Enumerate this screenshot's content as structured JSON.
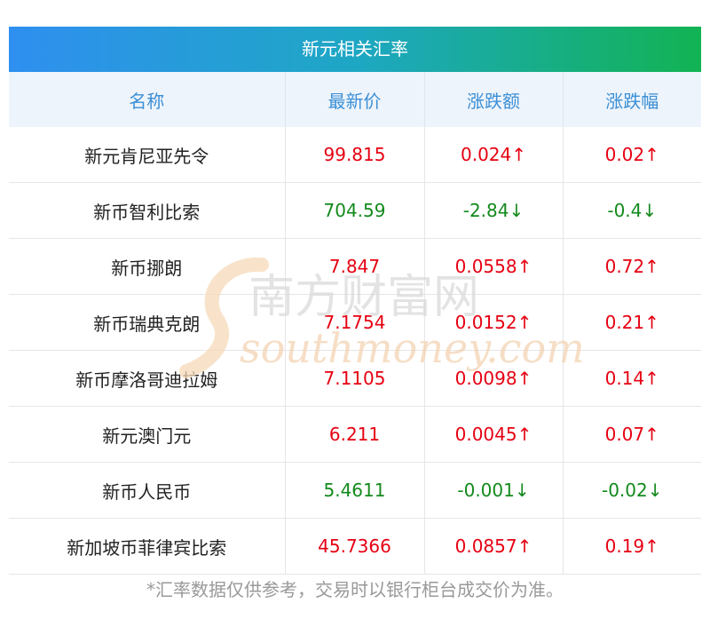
{
  "title": "新元相关汇率",
  "headers": [
    "名称",
    "最新价",
    "涨跌额",
    "涨跌幅"
  ],
  "rows": [
    {
      "name": "新元肯尼亚先令",
      "price": "99.815",
      "change": "0.024↑",
      "pct": "0.02↑",
      "dir": "up"
    },
    {
      "name": "新币智利比索",
      "price": "704.59",
      "change": "-2.84↓",
      "pct": "-0.4↓",
      "dir": "down"
    },
    {
      "name": "新币挪朗",
      "price": "7.847",
      "change": "0.0558↑",
      "pct": "0.72↑",
      "dir": "up"
    },
    {
      "name": "新币瑞典克朗",
      "price": "7.1754",
      "change": "0.0152↑",
      "pct": "0.21↑",
      "dir": "up"
    },
    {
      "name": "新币摩洛哥迪拉姆",
      "price": "7.1105",
      "change": "0.0098↑",
      "pct": "0.14↑",
      "dir": "up"
    },
    {
      "name": "新元澳门元",
      "price": "6.211",
      "change": "0.0045↑",
      "pct": "0.07↑",
      "dir": "up"
    },
    {
      "name": "新币人民币",
      "price": "5.4611",
      "change": "-0.001↓",
      "pct": "-0.02↓",
      "dir": "down"
    },
    {
      "name": "新加坡币菲律宾比索",
      "price": "45.7366",
      "change": "0.0857↑",
      "pct": "0.19↑",
      "dir": "up"
    }
  ],
  "watermark": {
    "cn": "南方财富网",
    "en": "southmoney.com"
  },
  "footer": "*汇率数据仅供参考，交易时以银行柜台成交价为准。",
  "colors": {
    "up": "#e60012",
    "down": "#138a1c",
    "header_text": "#3b8fd6",
    "title_start": "#2f8ff0",
    "title_end": "#12b353"
  }
}
